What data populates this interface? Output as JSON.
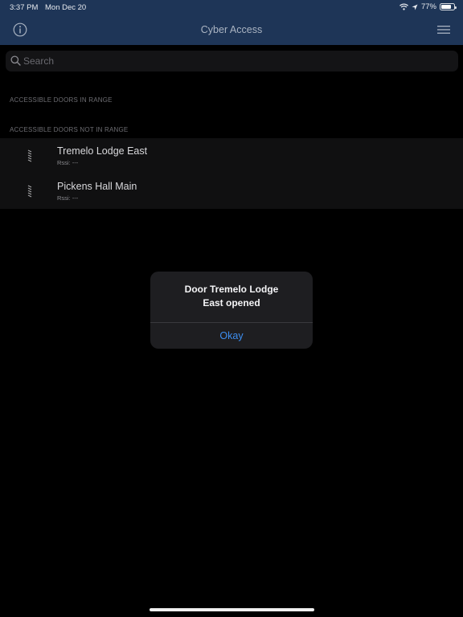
{
  "status_bar": {
    "time": "3:37 PM",
    "date": "Mon Dec 20",
    "battery": "77%",
    "battery_level": 0.77
  },
  "navbar": {
    "title": "Cyber Access"
  },
  "search": {
    "placeholder": "Search"
  },
  "sections": {
    "in_range": {
      "header": "ACCESSIBLE DOORS IN RANGE"
    },
    "not_in_range": {
      "header": "ACCESSIBLE DOORS NOT IN RANGE",
      "doors": [
        {
          "name": "Tremelo Lodge East",
          "rssi": "Rssi: ---"
        },
        {
          "name": "Pickens Hall Main",
          "rssi": "Rssi: ---"
        }
      ]
    }
  },
  "alert": {
    "line1": "Door Tremelo Lodge",
    "line2": "East opened",
    "button": "Okay"
  },
  "colors": {
    "navbar_bg": "#1e3557",
    "accent": "#3d8ef0",
    "background": "#000000"
  }
}
